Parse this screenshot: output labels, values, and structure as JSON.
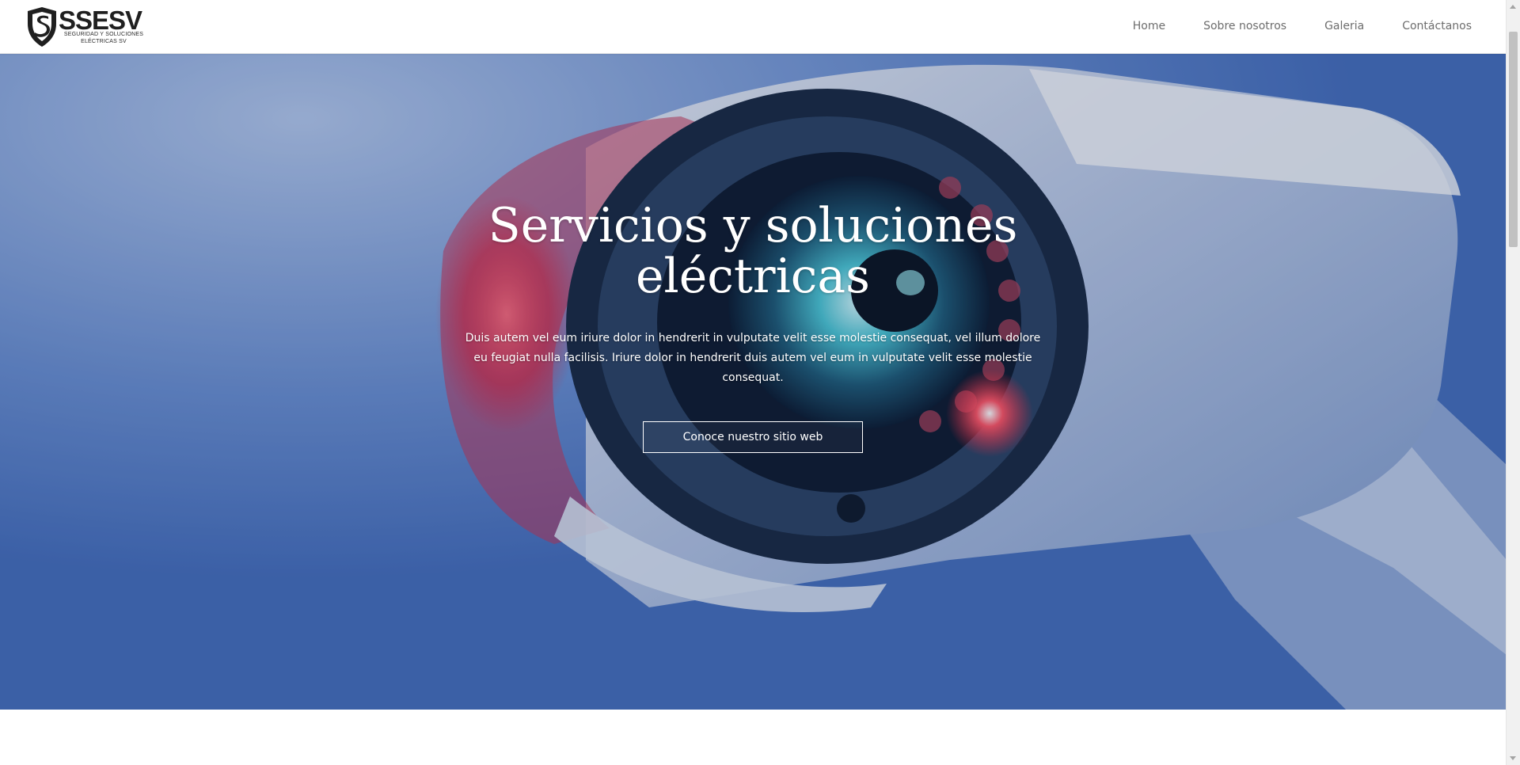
{
  "brand": {
    "name": "SSESV",
    "tagline_line1": "SEGURIDAD Y SOLUCIONES",
    "tagline_line2": "ELÉCTRICAS SV"
  },
  "nav": {
    "items": [
      {
        "label": "Home"
      },
      {
        "label": "Sobre nosotros"
      },
      {
        "label": "Galeria"
      },
      {
        "label": "Contáctanos"
      }
    ]
  },
  "hero": {
    "title": "Servicios y soluciones eléctricas",
    "text": "Duis autem vel eum iriure dolor in hendrerit in vulputate velit esse molestie consequat, vel illum dolore eu feugiat nulla facilisis. Iriure dolor in hendrerit duis autem vel eum in vulputate velit esse molestie consequat.",
    "button_label": "Conoce nuestro sitio web"
  },
  "colors": {
    "nav_text": "#6d6d6d",
    "hero_blue": "#5f87cf",
    "accent_red": "#e8283c"
  }
}
